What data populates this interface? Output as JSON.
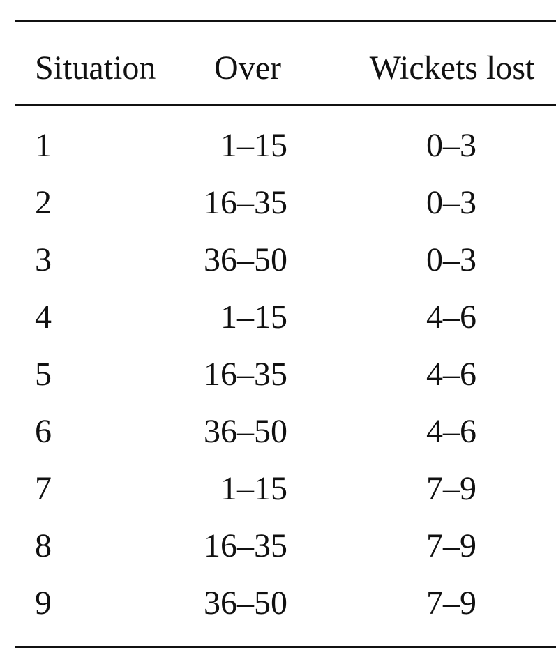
{
  "table": {
    "headers": [
      "Situation",
      "Over",
      "Wickets lost"
    ],
    "rows": [
      [
        "1",
        "1–15",
        "0–3"
      ],
      [
        "2",
        "16–35",
        "0–3"
      ],
      [
        "3",
        "36–50",
        "0–3"
      ],
      [
        "4",
        "1–15",
        "4–6"
      ],
      [
        "5",
        "16–35",
        "4–6"
      ],
      [
        "6",
        "36–50",
        "4–6"
      ],
      [
        "7",
        "1–15",
        "7–9"
      ],
      [
        "8",
        "16–35",
        "7–9"
      ],
      [
        "9",
        "36–50",
        "7–9"
      ]
    ]
  }
}
